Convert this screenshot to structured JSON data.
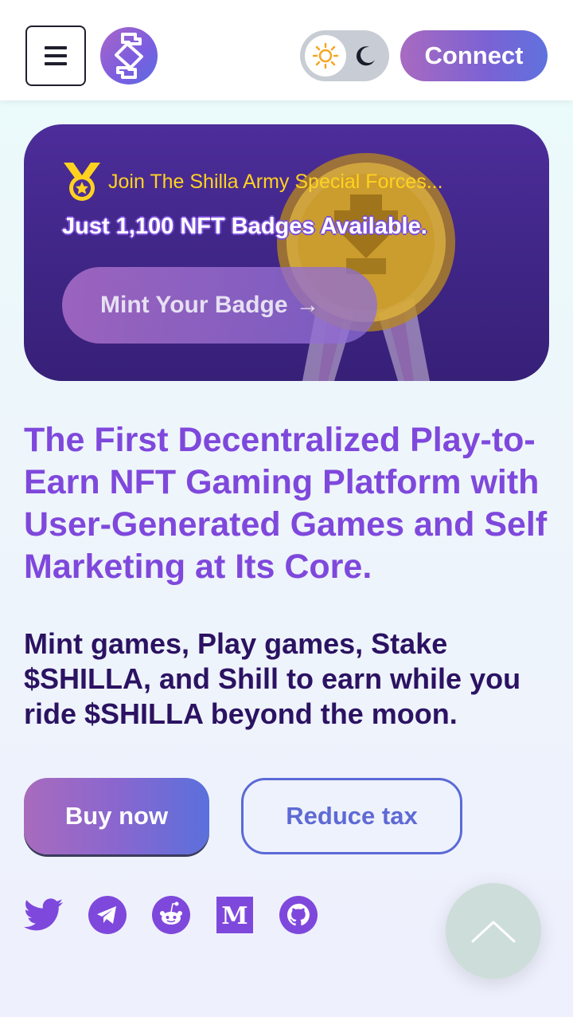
{
  "header": {
    "menu_icon": "hamburger-icon",
    "logo_icon": "shilla-logo-icon",
    "theme": {
      "light_icon": "sun-icon",
      "dark_icon": "moon-icon"
    },
    "connect_label": "Connect"
  },
  "banner": {
    "tag_icon": "medal-icon",
    "tag": "Join The Shilla Army Special Forces...",
    "title": "Just 1,100 NFT Badges Available.",
    "mint_label": "Mint Your Badge",
    "mint_arrow": "→"
  },
  "hero": {
    "headline": "The First Decentralized Play-to-Earn NFT Gaming Platform with User-Generated Games and Self Marketing at Its Core.",
    "subhead": "Mint games, Play games, Stake $SHILLA, and Shill to earn while you ride $SHILLA beyond the moon."
  },
  "actions": {
    "buy_label": "Buy now",
    "tax_label": "Reduce tax"
  },
  "social": [
    "twitter-icon",
    "telegram-icon",
    "reddit-icon",
    "medium-icon",
    "github-icon"
  ],
  "colors": {
    "accent_purple": "#7f48dc",
    "dark_text": "#2b1262",
    "gold": "#ffd21f",
    "banner_bg": "#3e2584"
  }
}
